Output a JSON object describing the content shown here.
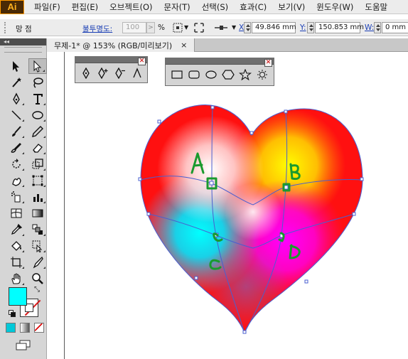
{
  "app": {
    "logo": "Ai"
  },
  "menu": [
    "파일(F)",
    "편집(E)",
    "오브젝트(O)",
    "문자(T)",
    "선택(S)",
    "효과(C)",
    "보기(V)",
    "윈도우(W)",
    "도움말"
  ],
  "control_bar": {
    "object_type": "망 점",
    "opacity_label": "불투명도:",
    "opacity_value": "100",
    "opacity_unit": "%",
    "x_label": "X:",
    "x_value": "49.846 mm",
    "y_label": "Y:",
    "y_value": "150.853 mm",
    "w_label": "W:",
    "w_value": "0 mm"
  },
  "document_tab": {
    "title": "무제-1* @ 153% (RGB/미리보기)",
    "close": "×"
  },
  "tools_panel": {
    "collapse": "◂◂"
  },
  "colors": {
    "fill": "#00ffff",
    "stroke": "none",
    "mesh_line": "#4a5fd0",
    "annotation": "#1a9a2e"
  },
  "artwork": {
    "description_labels": [
      "A",
      "B",
      "C",
      "D"
    ]
  }
}
